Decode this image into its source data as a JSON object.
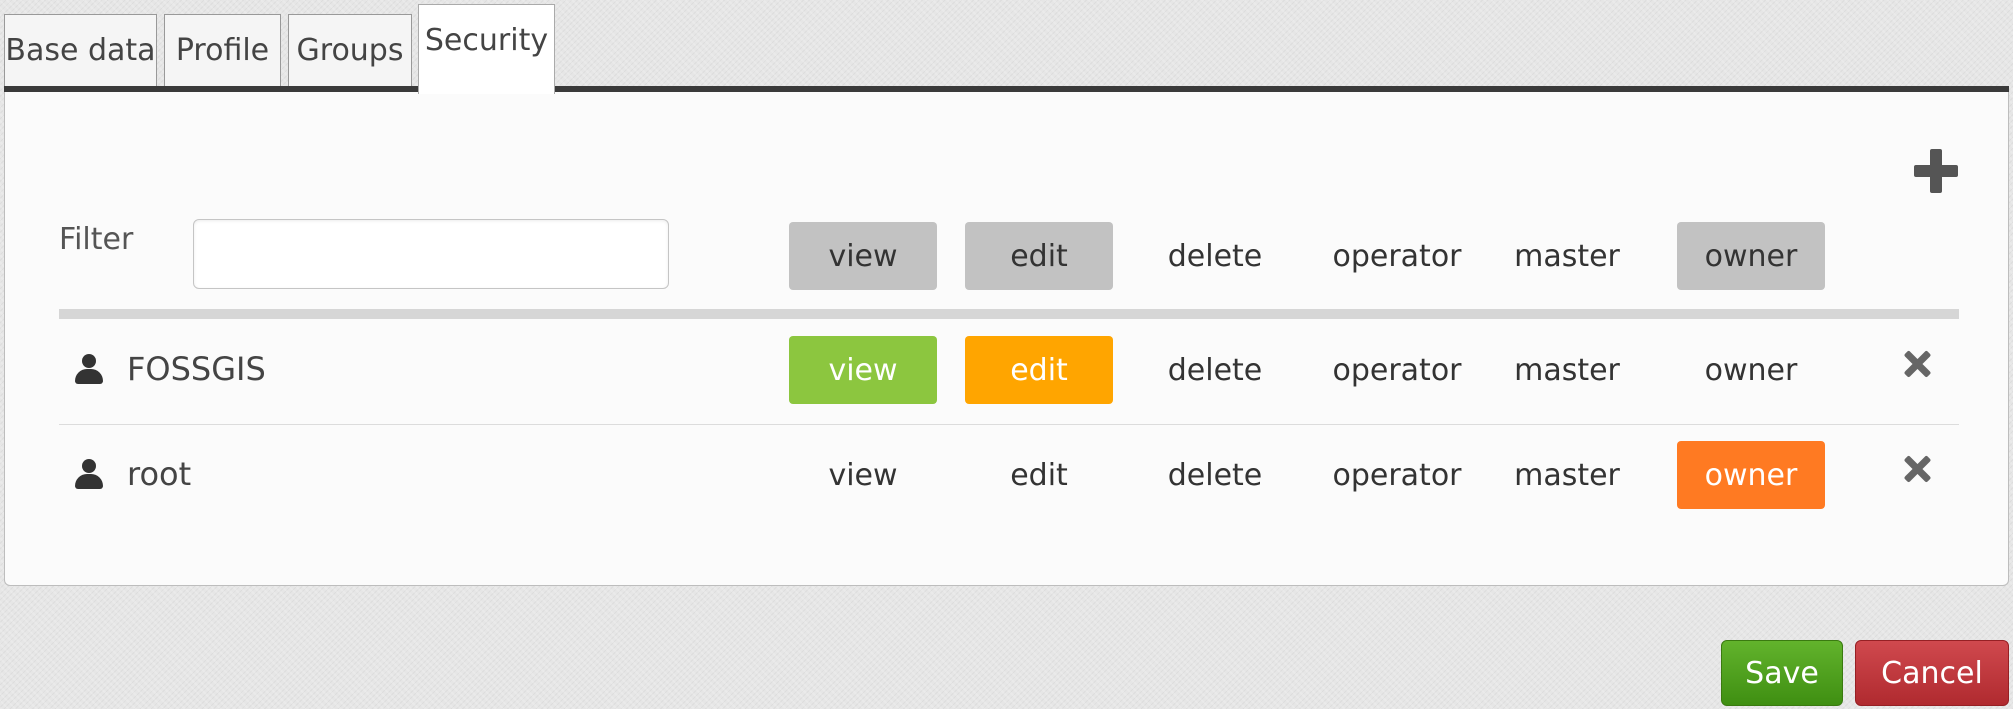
{
  "tabs": [
    {
      "label": "Base data",
      "active": false
    },
    {
      "label": "Profile",
      "active": false
    },
    {
      "label": "Groups",
      "active": false
    },
    {
      "label": "Security",
      "active": true
    }
  ],
  "security": {
    "filter_label": "Filter",
    "filter_value": "",
    "filter_placeholder": "",
    "add_icon": "plus-icon",
    "permissions_header": [
      {
        "label": "view",
        "highlighted": true
      },
      {
        "label": "edit",
        "highlighted": true
      },
      {
        "label": "delete",
        "highlighted": false
      },
      {
        "label": "operator",
        "highlighted": false
      },
      {
        "label": "master",
        "highlighted": false
      },
      {
        "label": "owner",
        "highlighted": true
      }
    ],
    "rows": [
      {
        "icon": "user-icon",
        "name": "FOSSGIS",
        "permissions": [
          {
            "label": "view",
            "state": "active",
            "color": "#8cc63f"
          },
          {
            "label": "edit",
            "state": "active",
            "color": "#ffa500"
          },
          {
            "label": "delete",
            "state": "inactive"
          },
          {
            "label": "operator",
            "state": "inactive"
          },
          {
            "label": "master",
            "state": "inactive"
          },
          {
            "label": "owner",
            "state": "inactive"
          }
        ],
        "remove_icon": "close-icon"
      },
      {
        "icon": "user-icon",
        "name": "root",
        "permissions": [
          {
            "label": "view",
            "state": "inactive"
          },
          {
            "label": "edit",
            "state": "inactive"
          },
          {
            "label": "delete",
            "state": "inactive"
          },
          {
            "label": "operator",
            "state": "inactive"
          },
          {
            "label": "master",
            "state": "inactive"
          },
          {
            "label": "owner",
            "state": "active",
            "color": "#ff7a22"
          }
        ],
        "remove_icon": "close-icon"
      }
    ]
  },
  "actions": {
    "save_label": "Save",
    "cancel_label": "Cancel"
  },
  "colors": {
    "header_highlight": "#c2c2c2",
    "view_active": "#8cc63f",
    "edit_active": "#ffa500",
    "owner_active": "#ff7a22",
    "save": "#4fa11f",
    "cancel": "#c0393e"
  }
}
